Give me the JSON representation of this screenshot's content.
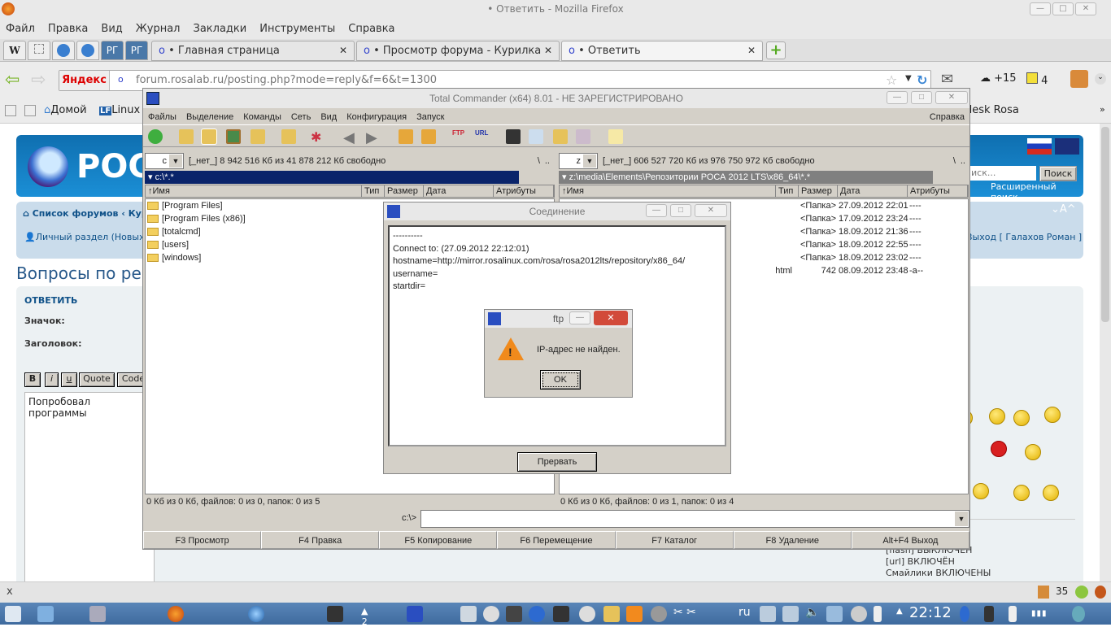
{
  "firefox": {
    "title": "• Ответить - Mozilla Firefox",
    "menu": [
      "Файл",
      "Правка",
      "Вид",
      "Журнал",
      "Закладки",
      "Инструменты",
      "Справка"
    ],
    "pinned_tabs": [
      "W",
      "",
      "",
      "",
      "РГ",
      "РГ"
    ],
    "tabs": [
      {
        "label": "• Главная страница"
      },
      {
        "label": "• Просмотр форума - Курилка"
      },
      {
        "label": "• Ответить"
      }
    ],
    "search_engine": "Яндекс",
    "url": "forum.rosalab.ru/posting.php?mode=reply&f=6&t=1300",
    "weather": "+15",
    "mail_count": "4",
    "bookmarks": [
      "Домой",
      "Linux",
      "desk Rosa"
    ],
    "findbar_close": "x",
    "status_count": "35"
  },
  "forum": {
    "logo": "РОС",
    "breadcrumb": "Список форумов ‹ Кур",
    "personal": "Личный раздел (Новых Л",
    "user_links": "Выход [ Галахов Роман ]",
    "font_ctrl": "⌄A^",
    "search_placeholder": "иск...",
    "search_button": "Поиск",
    "advanced_search": "Расширенный поиск",
    "topic_title": "Вопросы по репо",
    "reply_header": "ОТВЕТИТЬ",
    "icon_label": "Значок:",
    "subject_label": "Заголовок:",
    "format_buttons": [
      "B",
      "i",
      "u",
      "Quote",
      "Code"
    ],
    "message": "Попробовал программы",
    "options": [
      "[flash] ВЫКЛЮЧЕН",
      "[url] ВКЛЮЧЁН",
      "Смайлики ВКЛЮЧЕНЫ"
    ]
  },
  "tc": {
    "title": "Total Commander (x64) 8.01 - НЕ ЗАРЕГИСТРИРОВАНО",
    "menu": [
      "Файлы",
      "Выделение",
      "Команды",
      "Сеть",
      "Вид",
      "Конфигурация",
      "Запуск"
    ],
    "help": "Справка",
    "left": {
      "drive": "c",
      "info": "[_нет_]  8 942 516 Кб из 41 878 212 Кб свободно",
      "path": "c:\\*.*",
      "files": [
        "[Program Files]",
        "[Program Files (x86)]",
        "[totalcmd]",
        "[users]",
        "[windows]"
      ],
      "status": "0 Кб из 0 Кб, файлов: 0 из 0, папок: 0 из 5"
    },
    "right": {
      "drive": "z",
      "info": "[_нет_]  606 527 720 Кб из 976 750 972 Кб свободно",
      "path": "z:\\media\\Elements\\Репозитории РОСА 2012 LTS\\x86_64\\*.*",
      "rows": [
        {
          "type": "",
          "size": "<Папка>",
          "date": "27.09.2012 22:01",
          "attr": "----"
        },
        {
          "type": "",
          "size": "<Папка>",
          "date": "17.09.2012 23:24",
          "attr": "----"
        },
        {
          "type": "",
          "size": "<Папка>",
          "date": "18.09.2012 21:36",
          "attr": "----"
        },
        {
          "type": "",
          "size": "<Папка>",
          "date": "18.09.2012 22:55",
          "attr": "----"
        },
        {
          "type": "",
          "size": "<Папка>",
          "date": "18.09.2012 23:02",
          "attr": "----"
        },
        {
          "type": "html",
          "size": "742",
          "date": "08.09.2012 23:48",
          "attr": "-a--"
        }
      ],
      "status": "0 Кб из 0 Кб, файлов: 0 из 1, папок: 0 из 4"
    },
    "columns": [
      "↑Имя",
      "Тип",
      "Размер",
      "Дата",
      "Атрибуты"
    ],
    "cmd_prompt": "c:\\>",
    "fkeys": [
      "F3 Просмотр",
      "F4 Правка",
      "F5 Копирование",
      "F6 Перемещение",
      "F7 Каталог",
      "F8 Удаление",
      "Alt+F4 Выход"
    ]
  },
  "connect_dialog": {
    "title": "Соединение",
    "log": [
      "----------",
      "Connect to: (27.09.2012 22:12:01)",
      "hostname=http://mirror.rosalinux.com/rosa/rosa2012lts/repository/x86_64/",
      "username=",
      "startdir="
    ],
    "abort": "Прервать"
  },
  "ftp_dialog": {
    "title": "ftp",
    "message": "IP-адрес не найден.",
    "ok": "OK"
  },
  "taskbar": {
    "desktop": "2",
    "lang": "ru",
    "clock": "22:12"
  }
}
